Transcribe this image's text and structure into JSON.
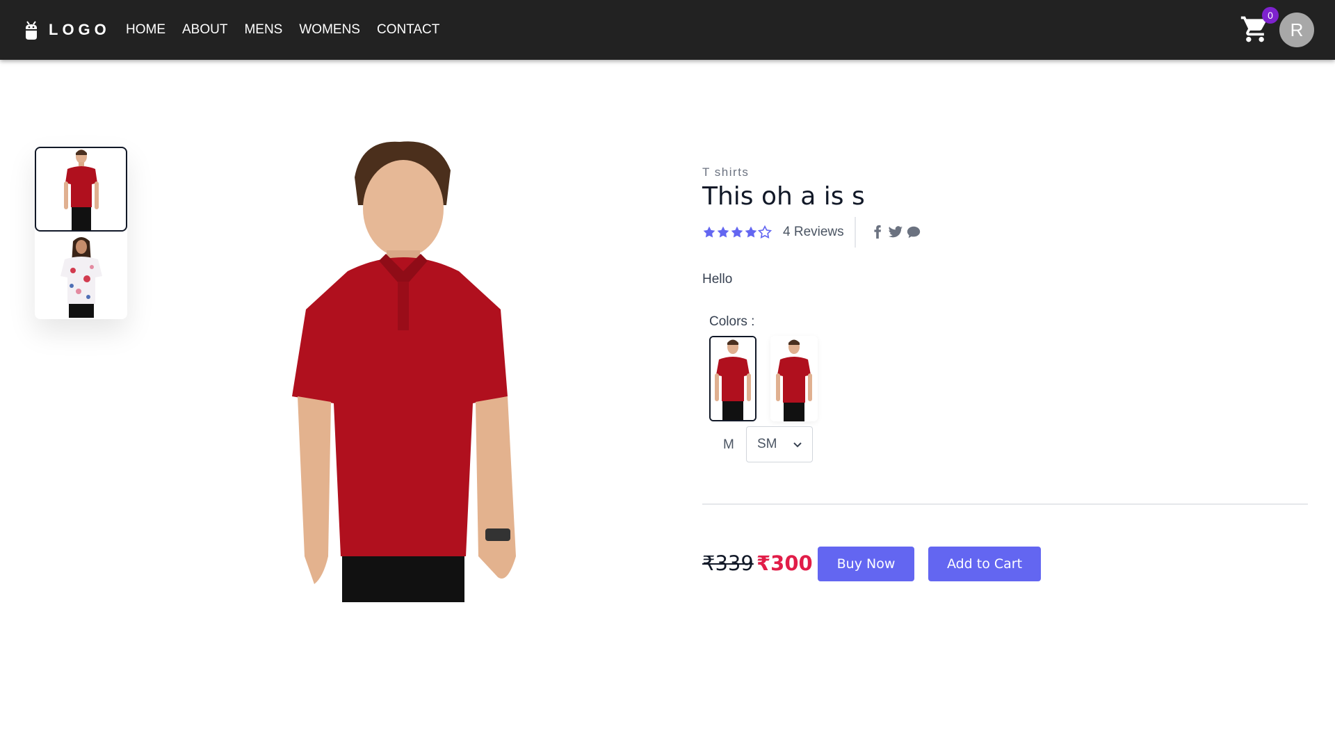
{
  "navbar": {
    "logo_text": "LOGO",
    "links": [
      "HOME",
      "ABOUT",
      "MENS",
      "WOMENS",
      "CONTACT"
    ],
    "cart_count": "0",
    "avatar_initial": "R"
  },
  "product": {
    "category": "T shirts",
    "title": "This oh a is s",
    "rating": 4,
    "rating_max": 5,
    "reviews_text": "4 Reviews",
    "description": "Hello",
    "colors_label": "Colors :",
    "size_label": "M",
    "size_selected": "SM",
    "old_price": "₹339",
    "new_price": "₹300",
    "buy_now_label": "Buy Now",
    "add_to_cart_label": "Add to Cart"
  },
  "colors": {
    "accent": "#6366f1",
    "price_red": "#e11d48",
    "navbar_bg": "#222222",
    "badge": "#7e22ce",
    "shirt_red": "#b0101e"
  },
  "icons": [
    "cart-icon",
    "facebook-icon",
    "twitter-icon",
    "chat-icon",
    "chevron-down-icon",
    "star-icon",
    "logo-icon"
  ]
}
